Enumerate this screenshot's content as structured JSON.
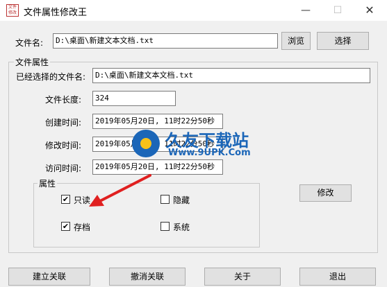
{
  "window": {
    "title": "文件属性修改王",
    "app_icon_text": "文件修改",
    "minimize": "—",
    "maximize": "☐",
    "close": "✕"
  },
  "top": {
    "file_label": "文件名:",
    "file_value": "D:\\桌面\\新建文本文档.txt",
    "browse_label": "浏览",
    "select_label": "选择"
  },
  "attrs": {
    "group_title": "文件属性",
    "selected_label": "已经选择的文件名:",
    "selected_value": "D:\\桌面\\新建文本文档.txt",
    "length_label": "文件长度:",
    "length_value": "324",
    "created_label": "创建时间:",
    "created_value": "2019年05月20日, 11时22分50秒",
    "modified_label": "修改时间:",
    "modified_value": "2019年05月20日, 11时22分50秒",
    "accessed_label": "访问时间:",
    "accessed_value": "2019年05月20日, 11时22分50秒",
    "modify_label": "修改"
  },
  "flags": {
    "group_title": "属性",
    "readonly": {
      "label": "只读",
      "checked": true
    },
    "hidden": {
      "label": "隐藏",
      "checked": false
    },
    "archive": {
      "label": "存档",
      "checked": true
    },
    "system": {
      "label": "系统",
      "checked": false
    }
  },
  "bottom": {
    "associate_label": "建立关联",
    "unassociate_label": "撤消关联",
    "about_label": "关于",
    "exit_label": "退出"
  },
  "watermark": {
    "brand": "久友下载站",
    "url": "Www.9UPK.Com"
  },
  "colors": {
    "arrow": "#e02020",
    "watermark": "#1b66b8"
  }
}
